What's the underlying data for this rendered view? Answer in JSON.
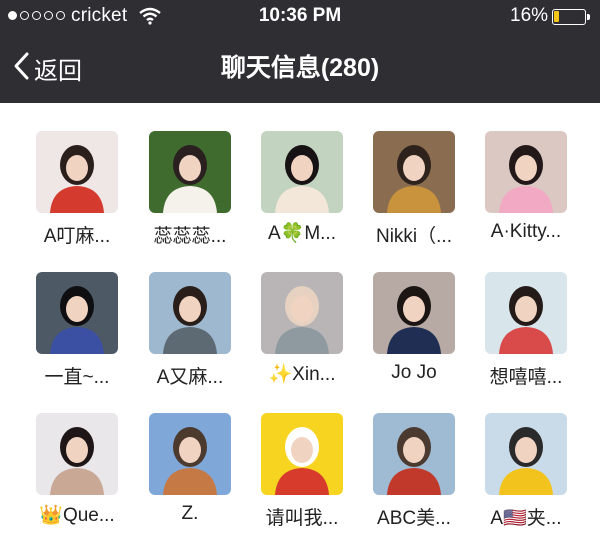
{
  "status_bar": {
    "carrier": "cricket",
    "time": "10:36 PM",
    "battery_percent": "16%",
    "battery_level": 0.16,
    "signal_bars_filled": 1,
    "signal_bars_total": 5
  },
  "nav": {
    "back_label": "返回",
    "title": "聊天信息(280)"
  },
  "members": [
    {
      "name": "A叮麻...",
      "avatar_colors": [
        "#efe6e6",
        "#d43a2e",
        "#2b1f1c"
      ]
    },
    {
      "name": "蕊蕊蕊...",
      "avatar_colors": [
        "#3f6b2e",
        "#f4f2ea",
        "#2a2020"
      ]
    },
    {
      "name": "A🍀M...",
      "avatar_colors": [
        "#c2d3c0",
        "#f2e7d9",
        "#171214"
      ]
    },
    {
      "name": "Nikki（...",
      "avatar_colors": [
        "#8a6d50",
        "#c9933d",
        "#2d221c"
      ]
    },
    {
      "name": "A·Kitty...",
      "avatar_colors": [
        "#dcc8c2",
        "#f2a9c4",
        "#22181a"
      ]
    },
    {
      "name": "一直~...",
      "avatar_colors": [
        "#4d5a66",
        "#3b4fa3",
        "#0f0f12"
      ]
    },
    {
      "name": "A又麻...",
      "avatar_colors": [
        "#9eb8cf",
        "#5d6a73",
        "#2a1e1a"
      ]
    },
    {
      "name": "✨Xin...",
      "avatar_colors": [
        "#b9b4b6",
        "#8e9aa0",
        "#e7d2c2"
      ]
    },
    {
      "name": "Jo Jo",
      "avatar_colors": [
        "#b7aaa4",
        "#1f2e52",
        "#1b1514"
      ]
    },
    {
      "name": "想嘻嘻...",
      "avatar_colors": [
        "#d8e6ec",
        "#d94a4a",
        "#241a18"
      ]
    },
    {
      "name": "👑Que...",
      "avatar_colors": [
        "#e9e7ea",
        "#c9a896",
        "#1d1516"
      ]
    },
    {
      "name": "Z.",
      "avatar_colors": [
        "#7fa7d8",
        "#c57a45",
        "#4c3a2f"
      ]
    },
    {
      "name": "请叫我...",
      "avatar_colors": [
        "#f7d420",
        "#d63b2b",
        "#ffffff"
      ]
    },
    {
      "name": "ABC美...",
      "avatar_colors": [
        "#9fbbd3",
        "#c0392b",
        "#4a3a30"
      ]
    },
    {
      "name": "A🇺🇸夹...",
      "avatar_colors": [
        "#c9dbe9",
        "#f2c31d",
        "#2a2a2a"
      ]
    }
  ]
}
